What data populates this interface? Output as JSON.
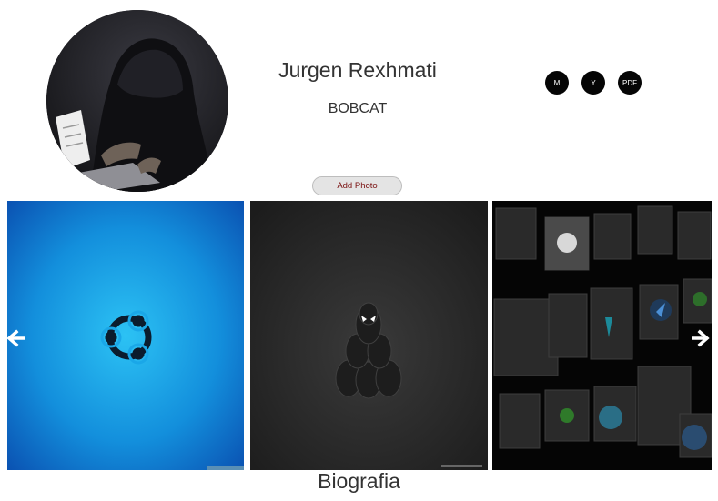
{
  "profile": {
    "name": "Jurgen Rexhmati",
    "subtitle": "BOBCAT",
    "avatar_icon": "hooded-hacker-avatar"
  },
  "social_buttons": [
    {
      "label": "M",
      "icon": "medium-icon"
    },
    {
      "label": "Y",
      "icon": "youtube-icon"
    },
    {
      "label": "PDF",
      "icon": "pdf-icon"
    }
  ],
  "actions": {
    "add_photo_label": "Add Photo"
  },
  "gallery": {
    "images": [
      {
        "icon": "ubuntu-wallpaper"
      },
      {
        "icon": "spiderman-stack-wallpaper"
      },
      {
        "icon": "os-logos-grid-wallpaper"
      }
    ],
    "prev_icon": "arrow-left-icon",
    "next_icon": "arrow-right-icon"
  },
  "bio": {
    "heading": "Biografia"
  },
  "colors": {
    "accent_dark": "#050505",
    "button_text": "#7a1010",
    "ubuntu_blue": "#1aa7e8"
  }
}
